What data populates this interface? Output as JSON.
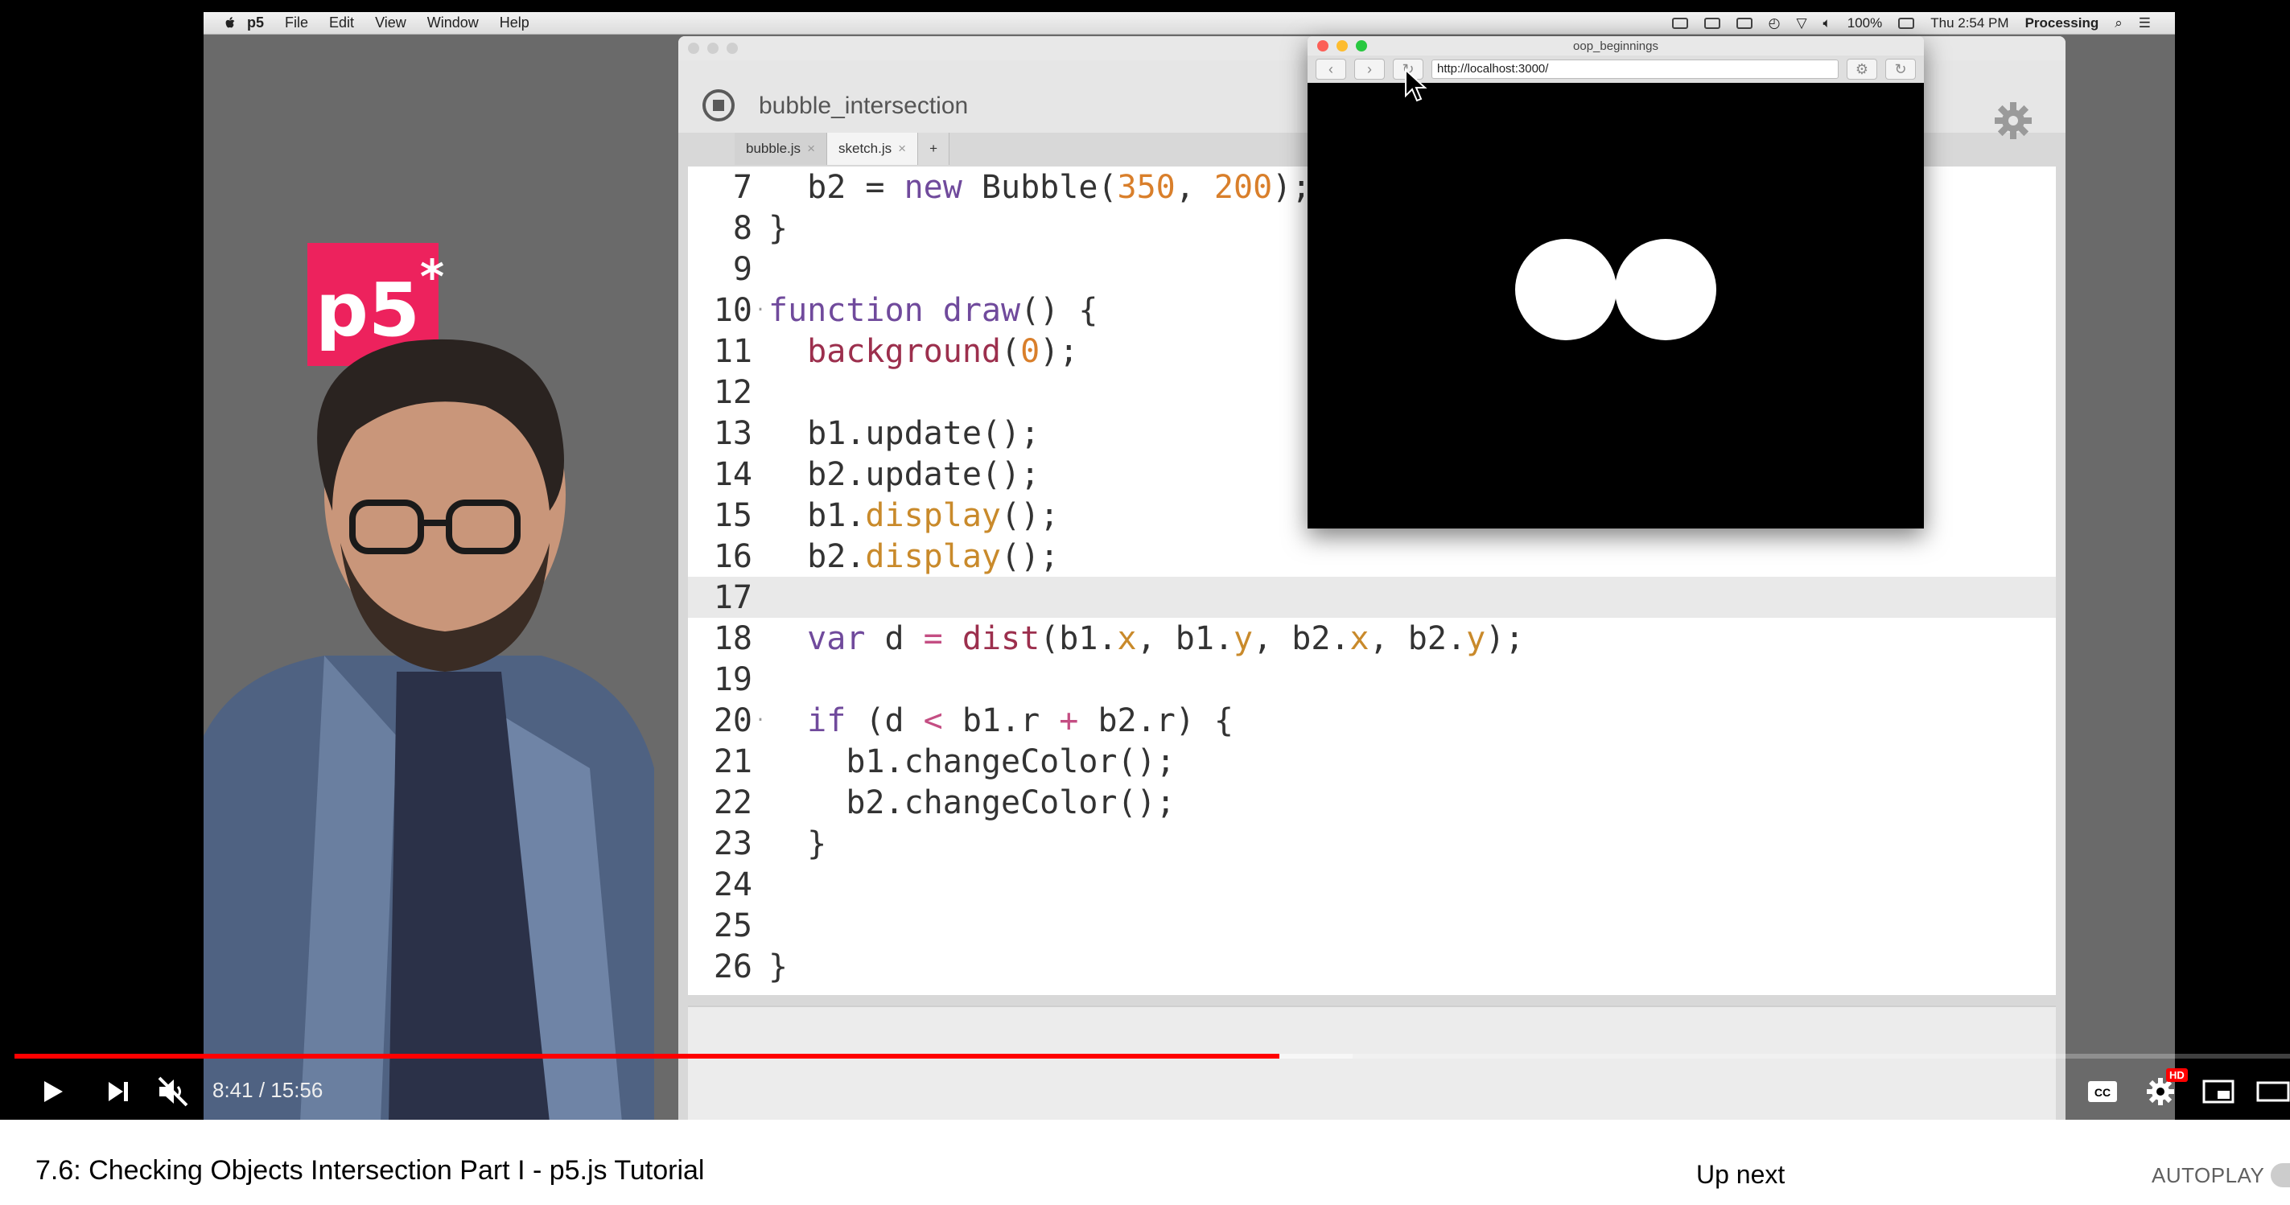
{
  "os_menubar": {
    "app_name": "p5",
    "menus": [
      "File",
      "Edit",
      "View",
      "Window",
      "Help"
    ],
    "battery": "100%",
    "clock": "Thu 2:54 PM",
    "active_app": "Processing"
  },
  "logo": {
    "text": "p5",
    "superscript": "*"
  },
  "editor": {
    "sketch_name": "bubble_intersection",
    "tabs": [
      {
        "label": "bubble.js",
        "close": "×"
      },
      {
        "label": "sketch.js",
        "close": "×"
      }
    ],
    "add_tab_label": "+",
    "lines": [
      {
        "num": "7",
        "html": "  b2 = <span class=\"kw\">new</span> Bubble(<span class=\"num\">350</span>, <span class=\"num\">200</span>);"
      },
      {
        "num": "8",
        "html": "}"
      },
      {
        "num": "9",
        "html": ""
      },
      {
        "num": "10",
        "fold": true,
        "html": "<span class=\"kw\">function</span> <span class=\"kw\">draw</span>() {"
      },
      {
        "num": "11",
        "html": "  <span class=\"fn\">background</span>(<span class=\"num\">0</span>);"
      },
      {
        "num": "12",
        "html": ""
      },
      {
        "num": "13",
        "html": "  b1.update();"
      },
      {
        "num": "14",
        "html": "  b2.update();"
      },
      {
        "num": "15",
        "html": "  b1.<span class=\"prop\">display</span>();"
      },
      {
        "num": "16",
        "html": "  b2.<span class=\"prop\">display</span>();"
      },
      {
        "num": "17",
        "highlight": true,
        "html": ""
      },
      {
        "num": "18",
        "html": "  <span class=\"kw\">var</span> d <span class=\"op\">=</span> <span class=\"fn\">dist</span>(b1.<span class=\"prop\">x</span>, b1.<span class=\"prop\">y</span>, b2.<span class=\"prop\">x</span>, b2.<span class=\"prop\">y</span>);"
      },
      {
        "num": "19",
        "html": ""
      },
      {
        "num": "20",
        "fold": true,
        "html": "  <span class=\"kw\">if</span> (d <span class=\"op\">&lt;</span> b1.r <span class=\"op\">+</span> b2.r) {"
      },
      {
        "num": "21",
        "html": "    b1.changeColor();"
      },
      {
        "num": "22",
        "html": "    b2.changeColor();"
      },
      {
        "num": "23",
        "html": "  }"
      },
      {
        "num": "24",
        "html": ""
      },
      {
        "num": "25",
        "html": ""
      },
      {
        "num": "26",
        "html": "}"
      }
    ]
  },
  "browser": {
    "title": "oop_beginnings",
    "url": "http://localhost:3000/"
  },
  "player": {
    "time_current": "8:41",
    "time_separator": " / ",
    "time_total": "15:56",
    "progress_played_fraction": 0.556,
    "progress_buffered_fraction": 0.588,
    "hd_badge": "HD"
  },
  "below": {
    "video_title": "7.6: Checking Objects Intersection Part I - p5.js Tutorial",
    "up_next": "Up next",
    "autoplay": "AUTOPLAY"
  }
}
